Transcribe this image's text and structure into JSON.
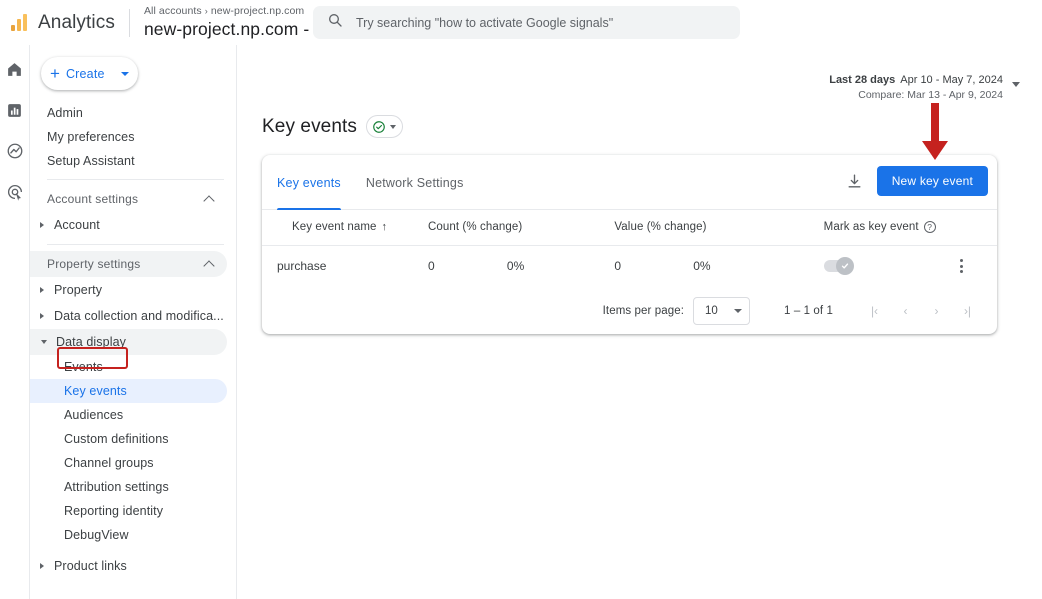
{
  "topbar": {
    "brand": "Analytics",
    "breadcrumb_all": "All accounts",
    "breadcrumb_sep": "›",
    "breadcrumb_prop": "new-project.np.com",
    "account_name": "new-project.np.com - UA",
    "search_placeholder": "Try searching \"how to activate Google signals\"",
    "search_value": "",
    "search_icon": "search-icon"
  },
  "rail": {
    "items": [
      {
        "name": "home-icon",
        "label": "Home"
      },
      {
        "name": "reports-icon",
        "label": "Reports"
      },
      {
        "name": "explore-icon",
        "label": "Explore"
      },
      {
        "name": "advertising-icon",
        "label": "Advertising"
      }
    ]
  },
  "sidebar": {
    "create_label": "Create",
    "items": [
      {
        "label": "Admin"
      },
      {
        "label": "My preferences"
      },
      {
        "label": "Setup Assistant"
      }
    ],
    "account_settings_label": "Account settings",
    "account_label": "Account",
    "property_settings_label": "Property settings",
    "property_label": "Property",
    "data_collection_label": "Data collection and modifica...",
    "data_display_label": "Data display",
    "data_display_children": [
      {
        "label": "Events",
        "selected": false
      },
      {
        "label": "Key events",
        "selected": true
      },
      {
        "label": "Audiences",
        "selected": false
      },
      {
        "label": "Custom definitions",
        "selected": false
      },
      {
        "label": "Channel groups",
        "selected": false
      },
      {
        "label": "Attribution settings",
        "selected": false
      },
      {
        "label": "Reporting identity",
        "selected": false
      },
      {
        "label": "DebugView",
        "selected": false
      }
    ],
    "product_links_label": "Product links"
  },
  "daterange": {
    "preset": "Last 28 days",
    "range": "Apr 10 - May 7, 2024",
    "compare": "Compare: Mar 13 - Apr 9, 2024"
  },
  "page": {
    "title": "Key events",
    "badge_icon": "check-circle-icon"
  },
  "card": {
    "tabs": [
      {
        "label": "Key events",
        "active": true
      },
      {
        "label": "Network Settings",
        "active": false
      }
    ],
    "download_icon": "download-icon",
    "new_button_label": "New key event"
  },
  "table": {
    "columns": [
      {
        "label": "Key event name",
        "sort": "↑"
      },
      {
        "label": "Count (% change)"
      },
      {
        "label": "Value (% change)"
      },
      {
        "label": "Mark as key event",
        "help": "?"
      }
    ],
    "rows": [
      {
        "name": "purchase",
        "count": "0",
        "count_change": "0%",
        "value": "0",
        "value_change": "0%",
        "marked": true,
        "menu_icon": "kebab-menu-icon"
      }
    ]
  },
  "pagination": {
    "items_per_page_label": "Items per page:",
    "items_per_page_value": "10",
    "range_label": "1 – 1 of 1",
    "first_icon": "|‹",
    "prev_icon": "‹",
    "next_icon": "›",
    "last_icon": "›|"
  },
  "annotation": {
    "arrow_color": "#c5221f"
  },
  "colors": {
    "accent_blue": "#1a73e8",
    "highlight_blue": "#e8f0fe",
    "annotation_red": "#c5221f",
    "check_green": "#188038"
  }
}
